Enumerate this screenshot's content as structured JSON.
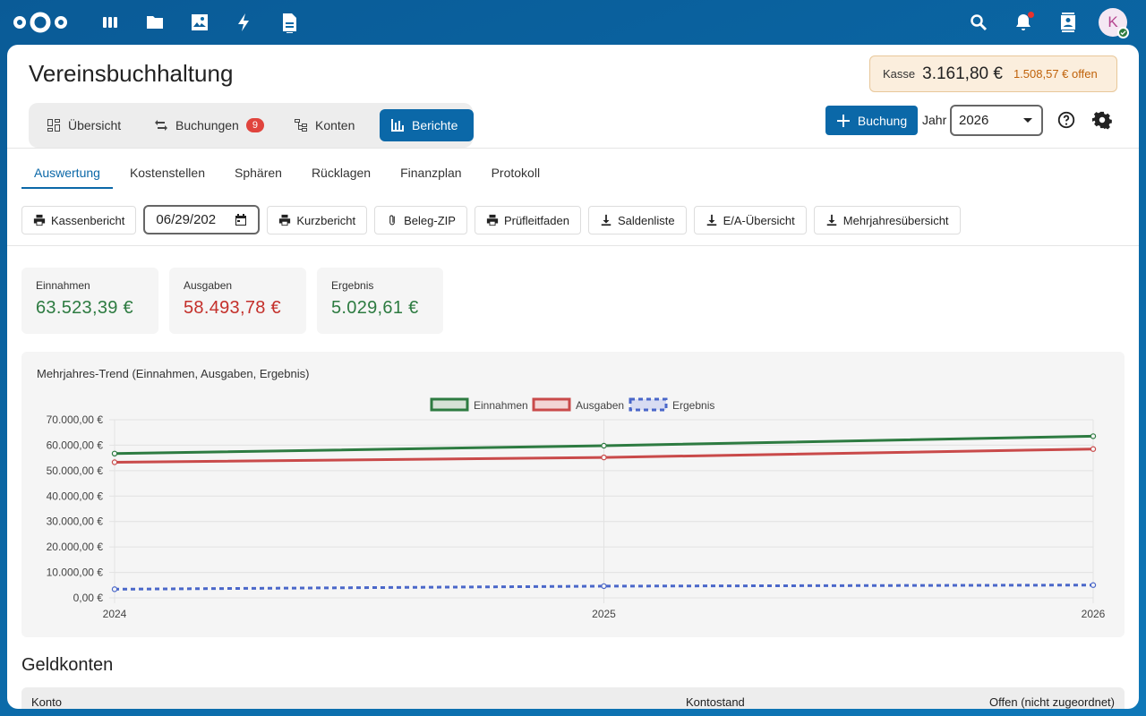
{
  "topbar": {
    "apps": [
      {
        "name": "dashboard-icon"
      },
      {
        "name": "files-icon"
      },
      {
        "name": "photos-icon"
      },
      {
        "name": "activity-icon"
      },
      {
        "name": "notes-icon"
      }
    ],
    "avatar_initial": "K"
  },
  "header": {
    "title": "Vereinsbuchhaltung",
    "kasse_label": "Kasse",
    "kasse_value": "3.161,80 €",
    "kasse_open": "1.508,57 € offen"
  },
  "tabs": [
    {
      "label": "Übersicht",
      "icon": "grid-icon"
    },
    {
      "label": "Buchungen",
      "icon": "swap-icon",
      "badge": "9"
    },
    {
      "label": "Konten",
      "icon": "accounts-icon"
    },
    {
      "label": "Berichte",
      "icon": "bar-chart-icon",
      "active": true
    }
  ],
  "actions": {
    "new_booking": "Buchung",
    "year_label": "Jahr",
    "year_value": "2026"
  },
  "subtabs": [
    "Auswertung",
    "Kostenstellen",
    "Sphären",
    "Rücklagen",
    "Finanzplan",
    "Protokoll"
  ],
  "toolbar": {
    "kassenbericht": "Kassenbericht",
    "date_value": "06/29/202",
    "kurzbericht": "Kurzbericht",
    "beleg_zip": "Beleg-ZIP",
    "pruefleitfaden": "Prüfleitfaden",
    "saldenliste": "Saldenliste",
    "ea_uebersicht": "E/A-Übersicht",
    "mehrjahres": "Mehrjahresübersicht"
  },
  "summary": {
    "income_label": "Einnahmen",
    "income_value": "63.523,39 €",
    "expense_label": "Ausgaben",
    "expense_value": "58.493,78 €",
    "result_label": "Ergebnis",
    "result_value": "5.029,61 €"
  },
  "chart_data": {
    "type": "line",
    "title": "Mehrjahres-Trend (Einnahmen, Ausgaben, Ergebnis)",
    "x": [
      "2024",
      "2025",
      "2026"
    ],
    "ylim": [
      0,
      70000
    ],
    "yticks": [
      "0,00 €",
      "10.000,00 €",
      "20.000,00 €",
      "30.000,00 €",
      "40.000,00 €",
      "50.000,00 €",
      "60.000,00 €",
      "70.000,00 €"
    ],
    "grid": true,
    "legend": "top-center",
    "series": [
      {
        "name": "Einnahmen",
        "values": [
          56700,
          59800,
          63523.39
        ],
        "color": "#2d7b41",
        "style": "solid"
      },
      {
        "name": "Ausgaben",
        "values": [
          53300,
          55200,
          58493.78
        ],
        "color": "#c94a4a",
        "style": "solid"
      },
      {
        "name": "Ergebnis",
        "values": [
          3400,
          4600,
          5029.61
        ],
        "color": "#4a67c9",
        "style": "dashed"
      }
    ]
  },
  "geldkonten": {
    "title": "Geldkonten",
    "columns": [
      "Konto",
      "Kontostand",
      "Offen (nicht zugeordnet)"
    ]
  }
}
